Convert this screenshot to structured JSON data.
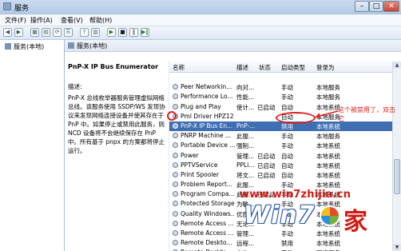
{
  "window": {
    "title": "服务"
  },
  "menu": [
    "文件(F)",
    "操作(A)",
    "查看(V)",
    "帮助(H)"
  ],
  "toolbar": {
    "buttons": [
      {
        "name": "back-button",
        "glyph": "◀"
      },
      {
        "name": "forward-button",
        "glyph": "▶"
      },
      {
        "name": "show-hide-tree-button",
        "glyph": "▦"
      },
      {
        "name": "properties-button",
        "glyph": "▤"
      },
      {
        "name": "refresh-button",
        "glyph": "⟳"
      },
      {
        "name": "export-list-button",
        "glyph": "⎘"
      },
      {
        "name": "help-button",
        "glyph": "?"
      },
      {
        "name": "view-button",
        "glyph": "▥"
      },
      {
        "name": "start-service-button",
        "glyph": "▶"
      },
      {
        "name": "stop-service-button",
        "glyph": "■"
      },
      {
        "name": "pause-service-button",
        "glyph": "‖"
      },
      {
        "name": "restart-service-button",
        "glyph": "▶‖"
      }
    ]
  },
  "tree": {
    "root": "服务(本地)"
  },
  "pane": {
    "header": "服务(本地)",
    "selected_name": "PnP-X IP Bus Enumerator",
    "desc_label": "描述:",
    "desc_text": "PnP-X 总线枚举器服务管理虚拟网络总线。该服务使用 SSDP/WS 发现协议来发现网络连接设备并使其存在于 PnP 中。如果停止或禁用此服务，则 NCD 设备将不会继续保存在 PnP 中。所有基于 pnpx 的方案都将停止运行。"
  },
  "columns": {
    "name": "名称",
    "desc": "描述",
    "state": "状态",
    "start": "启动类型",
    "logon": "登录为"
  },
  "rows": [
    {
      "name": "",
      "desc": "",
      "state": "",
      "start": "",
      "logon": ""
    },
    {
      "name": "Peer Networkin...",
      "desc": "向对...",
      "state": "",
      "start": "手动",
      "logon": "本地服务"
    },
    {
      "name": "Performance Lo...",
      "desc": "性能...",
      "state": "",
      "start": "手动",
      "logon": "本地服务"
    },
    {
      "name": "Plug and Play",
      "desc": "使计...",
      "state": "已启动",
      "start": "自动",
      "logon": "本地系统"
    },
    {
      "name": "Pml Driver HPZ12",
      "desc": "",
      "state": "",
      "start": "自动",
      "logon": "本地服务"
    },
    {
      "name": "PnP-X IP Bus En...",
      "desc": "PnP-...",
      "state": "",
      "start": "禁用",
      "logon": "本地系统"
    },
    {
      "name": "PNRP Machine ...",
      "desc": "此服...",
      "state": "",
      "start": "手动",
      "logon": "本地服务"
    },
    {
      "name": "Portable Device ...",
      "desc": "强制...",
      "state": "",
      "start": "手动",
      "logon": "本地系统"
    },
    {
      "name": "Power",
      "desc": "管理...",
      "state": "已启动",
      "start": "自动",
      "logon": "本地系统"
    },
    {
      "name": "PPTVService",
      "desc": "PPLi...",
      "state": "已启动",
      "start": "自动",
      "logon": "本地系统"
    },
    {
      "name": "Print Spooler",
      "desc": "将文...",
      "state": "已启动",
      "start": "自动",
      "logon": "本地系统"
    },
    {
      "name": "Problem Report...",
      "desc": "此服...",
      "state": "",
      "start": "手动",
      "logon": "本地系统"
    },
    {
      "name": "Program Compa...",
      "desc": "此服...",
      "state": "已启动",
      "start": "手动",
      "logon": "本地系统"
    },
    {
      "name": "Protected Storage",
      "desc": "为敏...",
      "state": "",
      "start": "手动",
      "logon": "本地系统"
    },
    {
      "name": "Quality Windows...",
      "desc": "优质...",
      "state": "",
      "start": "手动",
      "logon": "本地服务"
    },
    {
      "name": "Remote Access ...",
      "desc": "无论...",
      "state": "",
      "start": "手动",
      "logon": "本地系统"
    },
    {
      "name": "Remote Access ...",
      "desc": "管理...",
      "state": "",
      "start": "手动",
      "logon": "本地系统"
    },
    {
      "name": "Remote Deskto...",
      "desc": "远程...",
      "state": "",
      "start": "禁用",
      "logon": "本地系统"
    },
    {
      "name": "Remote Deskto...",
      "desc": "允许...",
      "state": "",
      "start": "手动",
      "logon": "网络服务"
    }
  ],
  "selected_row_index": 5,
  "annotation": {
    "text": "这个被禁用了，双击它"
  },
  "watermark": {
    "url": "www.win7zhijia.cn",
    "logo": "Win7",
    "suffix": "家"
  },
  "colors": {
    "accent": "#3f6fb3",
    "annotation": "#e0221a"
  }
}
